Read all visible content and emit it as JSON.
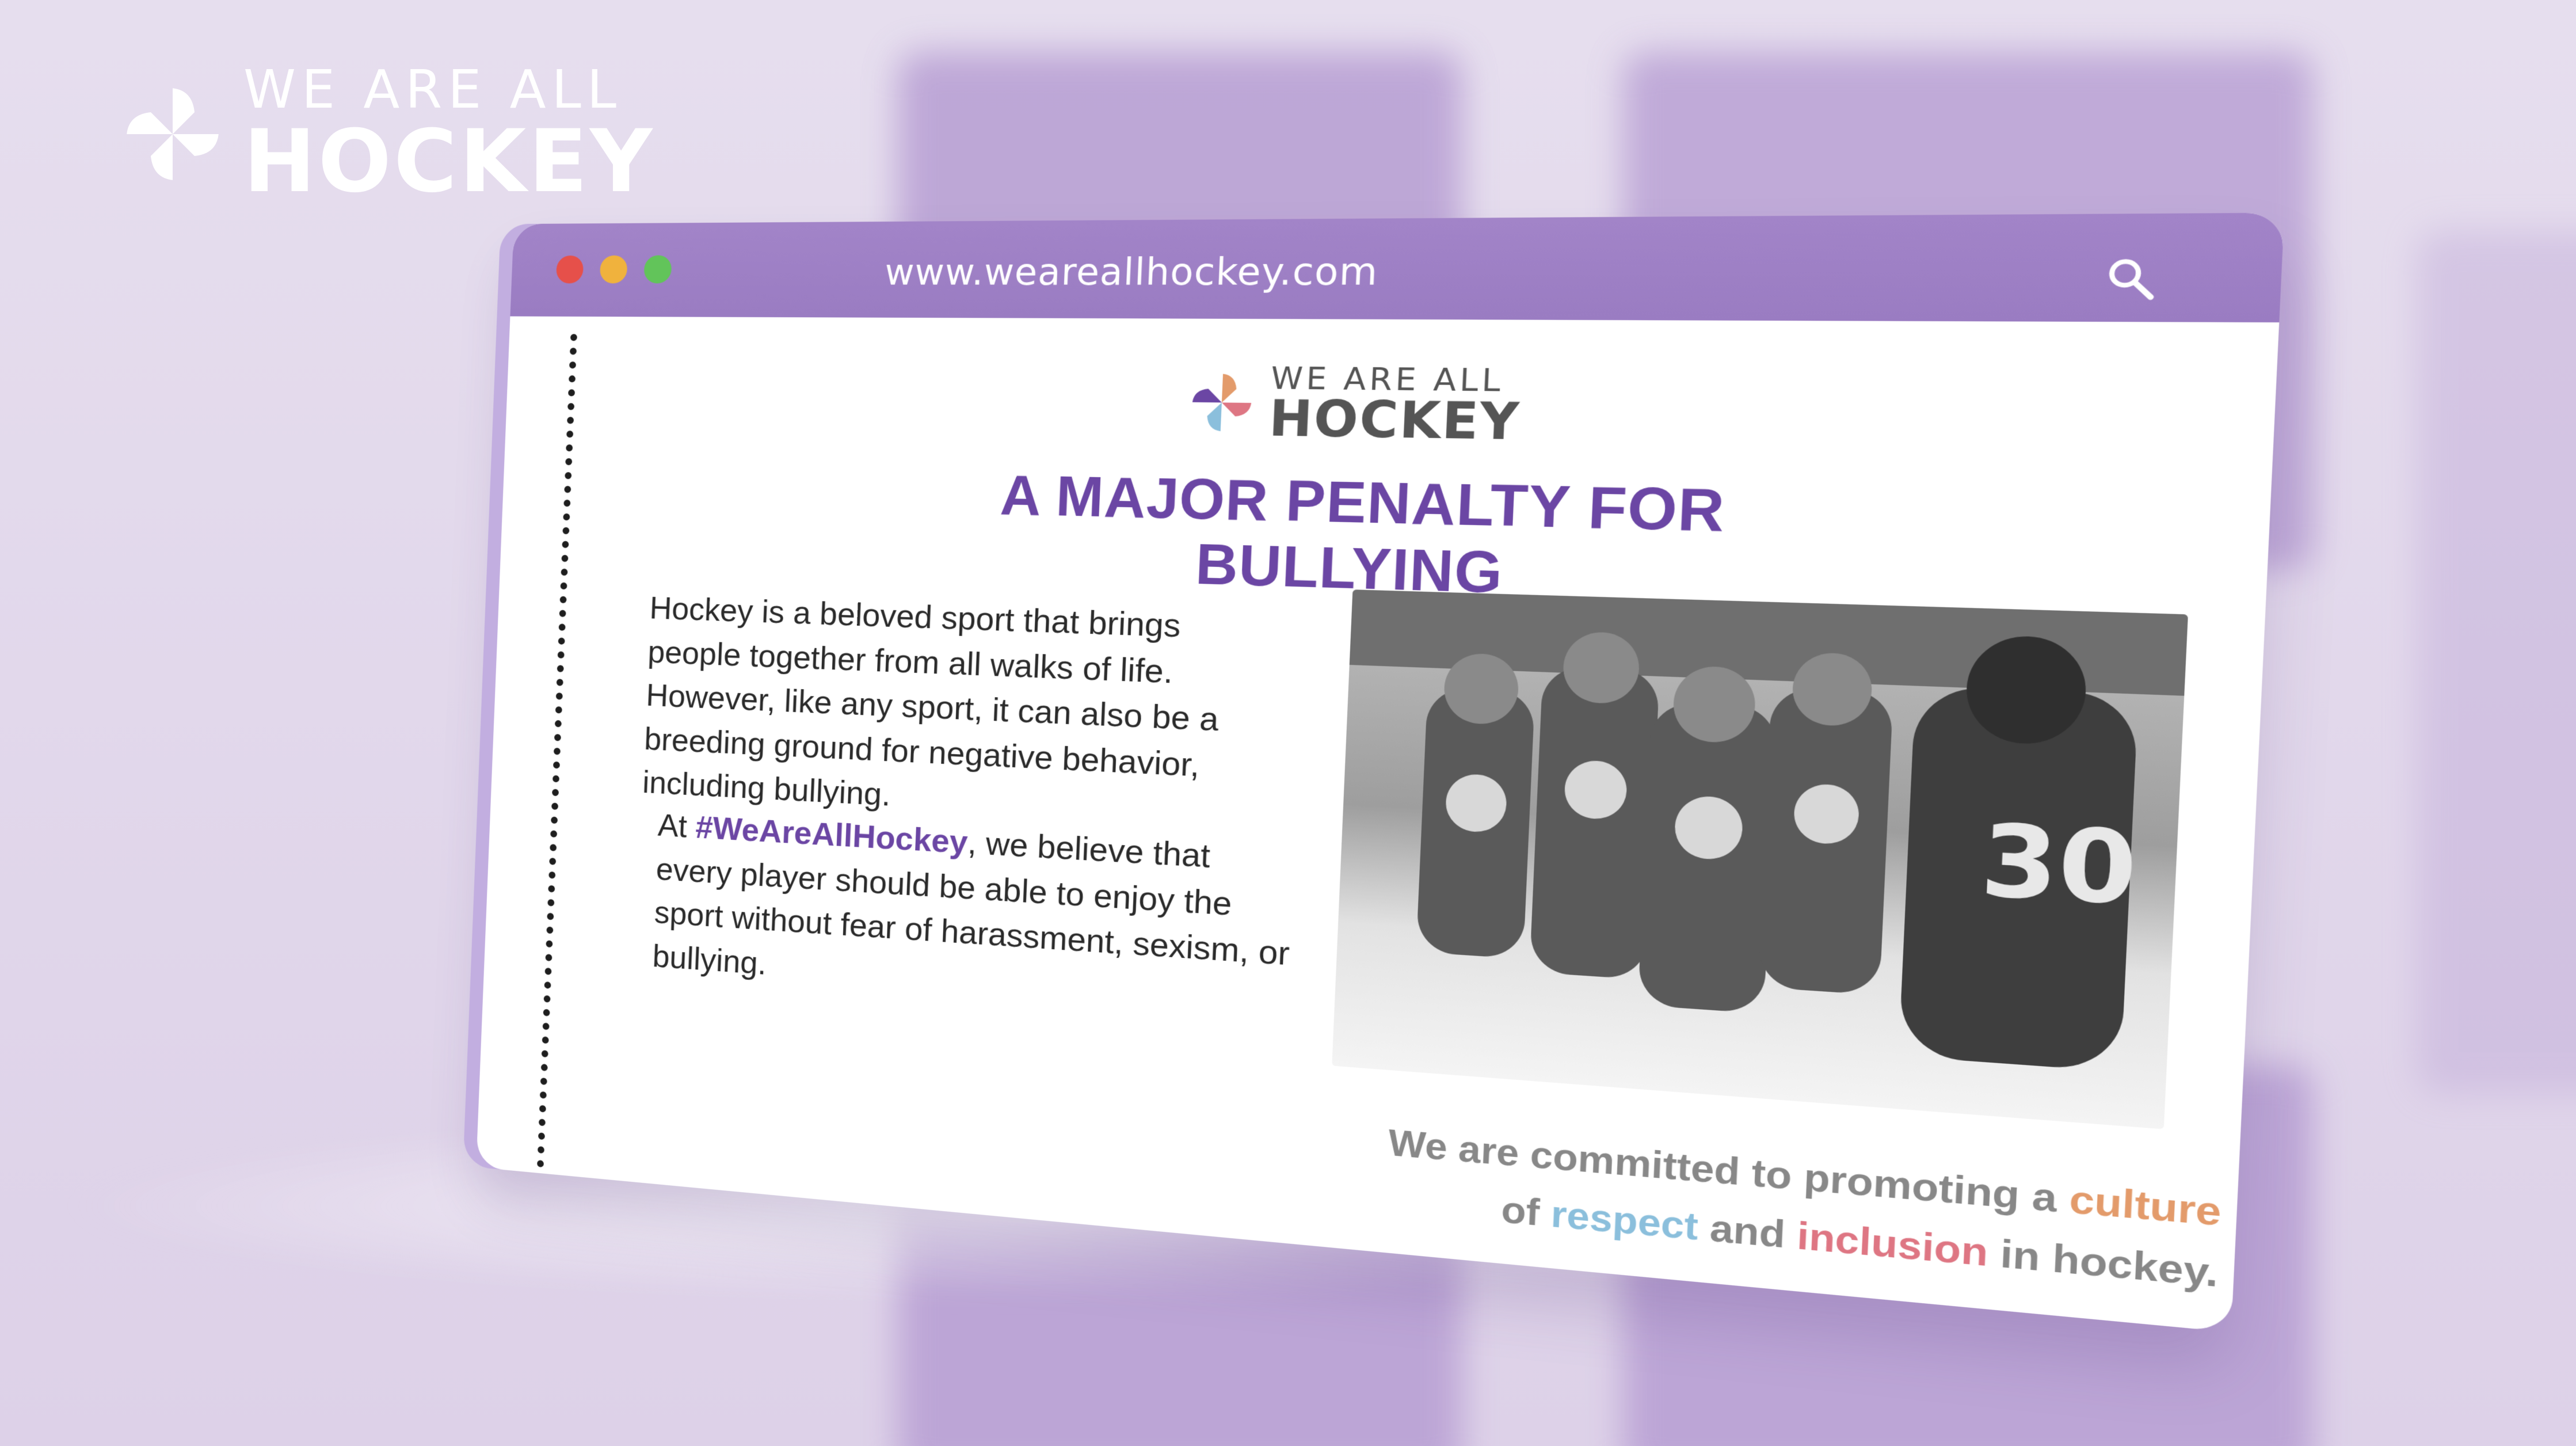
{
  "brand": {
    "small_text": "WE ARE ALL",
    "big_text": "HOCKEY",
    "logo_icon": "pinwheel-logo-icon"
  },
  "browser": {
    "url": "www.weareallhockey.com",
    "window_buttons": [
      "close-button",
      "minimize-button",
      "maximize-button"
    ],
    "search_icon": "search-icon",
    "colors": {
      "titlebar": "#9a7cc2",
      "close": "#e6504a",
      "minimize": "#f0b23d",
      "maximize": "#62c45a"
    }
  },
  "page": {
    "logo": {
      "small_text": "WE ARE ALL",
      "big_text": "HOCKEY"
    },
    "headline": "A MAJOR PENALTY FOR BULLYING",
    "paragraph1": "Hockey is a beloved sport that brings people together from all walks of life. However, like any sport, it can also be a breeding ground for negative behavior, including bullying.",
    "paragraph2": {
      "lead": "At ",
      "hashtag": "#WeAreAllHockey",
      "rest": ", we believe that every player should be able to enjoy the sport without fear of harassment, sexism, or bullying."
    },
    "photo_alt": "hockey-team-photo",
    "commitment": {
      "part1": "We are committed to promoting a ",
      "culture": "culture",
      "part2": "of ",
      "respect": "respect",
      "part3": " and ",
      "inclusion": "inclusion",
      "part4": " in hockey."
    },
    "colors": {
      "headline": "#6b46a4",
      "hashtag": "#6b46a4",
      "culture": "#e39b6b",
      "respect": "#8bbfdc",
      "inclusion": "#de7683"
    }
  }
}
